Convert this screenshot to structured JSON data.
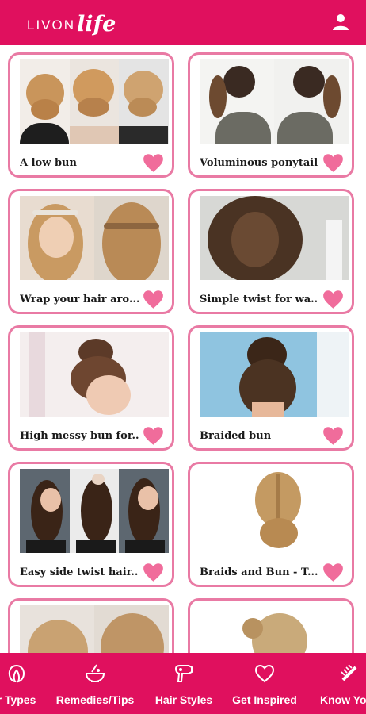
{
  "header": {
    "logo_part1": "LIVON",
    "logo_part2": "life",
    "profile_icon": "user-icon"
  },
  "colors": {
    "brand": "#e0105e",
    "card_border": "#e97aa4",
    "heart": "#f06c9b"
  },
  "cards": [
    {
      "title": "A low bun",
      "icon": "heart-icon"
    },
    {
      "title": "Voluminous ponytail",
      "icon": "heart-icon"
    },
    {
      "title": "Wrap your hair aro...",
      "icon": "heart-icon"
    },
    {
      "title": "Simple twist for wa...",
      "icon": "heart-icon"
    },
    {
      "title": "High messy bun for...",
      "icon": "heart-icon"
    },
    {
      "title": "Braided bun",
      "icon": "heart-icon"
    },
    {
      "title": "Easy side twist hair...",
      "icon": "heart-icon"
    },
    {
      "title": "Braids and Bun - T...",
      "icon": "heart-icon"
    },
    {
      "title": "",
      "icon": "heart-icon"
    },
    {
      "title": "",
      "icon": "heart-icon"
    }
  ],
  "bottom_nav": {
    "items": [
      {
        "label": "r Types",
        "icon": "hair-types-icon"
      },
      {
        "label": "Remedies/Tips",
        "icon": "remedies-bowl-icon"
      },
      {
        "label": "Hair Styles",
        "icon": "hair-dryer-icon"
      },
      {
        "label": "Get Inspired",
        "icon": "heart-outline-icon"
      },
      {
        "label": "Know You",
        "icon": "comb-icon"
      }
    ],
    "active": "Hair Styles"
  }
}
